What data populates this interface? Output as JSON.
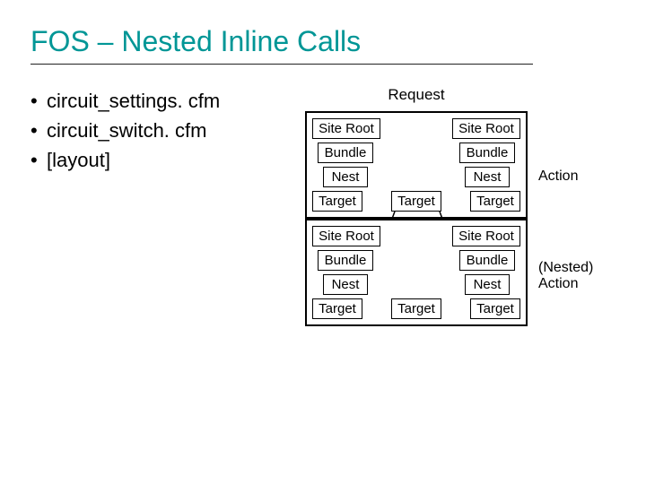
{
  "title": "FOS – Nested Inline Calls",
  "bullets": {
    "items": [
      "circuit_settings. cfm",
      "circuit_switch. cfm",
      "[layout]"
    ],
    "marker": "•"
  },
  "diagram": {
    "request_label": "Request",
    "blocks": [
      {
        "side_label": "Action",
        "rows": [
          [
            "Site Root",
            "Site Root"
          ],
          [
            "Bundle",
            "Bundle"
          ],
          [
            "Nest",
            "Nest"
          ],
          [
            "Target",
            "Target",
            "Target"
          ]
        ]
      },
      {
        "side_label": "(Nested)\nAction",
        "rows": [
          [
            "Site Root",
            "Site Root"
          ],
          [
            "Bundle",
            "Bundle"
          ],
          [
            "Nest",
            "Nest"
          ],
          [
            "Target",
            "Target",
            "Target"
          ]
        ]
      }
    ]
  }
}
